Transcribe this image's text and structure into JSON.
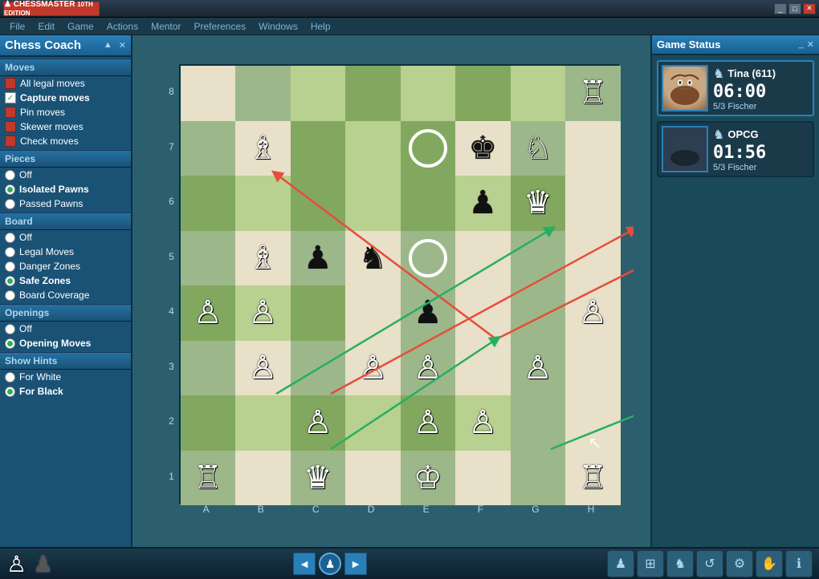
{
  "titlebar": {
    "logo": "CHESSMASTER",
    "subtitle": "10TH EDITION",
    "controls": [
      "_",
      "□",
      "✕"
    ]
  },
  "menubar": {
    "items": [
      "File",
      "Edit",
      "Game",
      "Actions",
      "Mentor",
      "Preferences",
      "Windows",
      "Help"
    ]
  },
  "coach": {
    "title": "Chess Coach",
    "triangle": "▲",
    "close": "✕",
    "sections": {
      "moves": {
        "label": "Moves",
        "options": [
          {
            "label": "All legal moves",
            "type": "checkbox",
            "checked": false
          },
          {
            "label": "Capture moves",
            "type": "checkbox",
            "checked": true
          },
          {
            "label": "Pin moves",
            "type": "checkbox",
            "checked": true
          },
          {
            "label": "Skewer moves",
            "type": "checkbox",
            "checked": true
          },
          {
            "label": "Check moves",
            "type": "checkbox",
            "checked": false
          }
        ]
      },
      "pieces": {
        "label": "Pieces",
        "options": [
          {
            "label": "Off",
            "type": "radio",
            "checked": false
          },
          {
            "label": "Isolated Pawns",
            "type": "radio",
            "checked": true
          },
          {
            "label": "Passed Pawns",
            "type": "radio",
            "checked": false
          }
        ]
      },
      "board": {
        "label": "Board",
        "options": [
          {
            "label": "Off",
            "type": "radio",
            "checked": false
          },
          {
            "label": "Legal Moves",
            "type": "radio",
            "checked": false
          },
          {
            "label": "Danger Zones",
            "type": "radio",
            "checked": false
          },
          {
            "label": "Safe Zones",
            "type": "radio",
            "checked": true
          },
          {
            "label": "Board Coverage",
            "type": "radio",
            "checked": false
          }
        ]
      },
      "openings": {
        "label": "Openings",
        "options": [
          {
            "label": "Off",
            "type": "radio",
            "checked": false
          },
          {
            "label": "Opening Moves",
            "type": "radio",
            "checked": true
          }
        ]
      },
      "hints": {
        "label": "Show Hints",
        "options": [
          {
            "label": "For White",
            "type": "radio",
            "checked": false
          },
          {
            "label": "For Black",
            "type": "radio",
            "checked": true
          }
        ]
      }
    }
  },
  "board": {
    "files": [
      "A",
      "B",
      "C",
      "D",
      "E",
      "F",
      "G",
      "H"
    ],
    "ranks": [
      "8",
      "7",
      "6",
      "5",
      "4",
      "3",
      "2",
      "1"
    ]
  },
  "game_status": {
    "title": "Game Status",
    "close": "✕",
    "player1": {
      "name": "Tina (611)",
      "time": "06:00",
      "level": "5/3 Fischer",
      "active": true
    },
    "player2": {
      "name": "OPCG",
      "time": "01:56",
      "level": "5/3 Fischer",
      "active": false
    }
  },
  "bottom": {
    "nav_btn": "►",
    "icons": [
      "♟",
      "♟",
      "♘",
      "☆",
      "⚙",
      "✋"
    ]
  }
}
